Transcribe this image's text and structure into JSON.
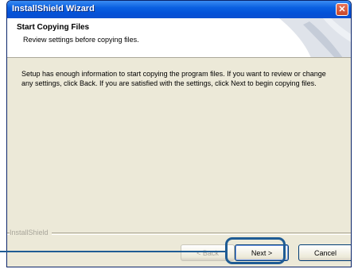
{
  "window": {
    "title": "InstallShield Wizard",
    "close_symbol": "✕"
  },
  "header": {
    "title": "Start Copying Files",
    "subtitle": "Review settings before copying files."
  },
  "body": {
    "message": "Setup has enough information to start copying the program files.  If you want to review or change any settings, click Back.  If you are satisfied with the settings, click Next to begin copying files."
  },
  "footer": {
    "brand": "InstallShield"
  },
  "buttons": {
    "back_label": "< Back",
    "next_label": "Next >",
    "cancel_label": "Cancel"
  },
  "colors": {
    "titlebar": "#0a5fe0",
    "dialog_bg": "#ece9d8",
    "highlight": "#1f5c94"
  }
}
